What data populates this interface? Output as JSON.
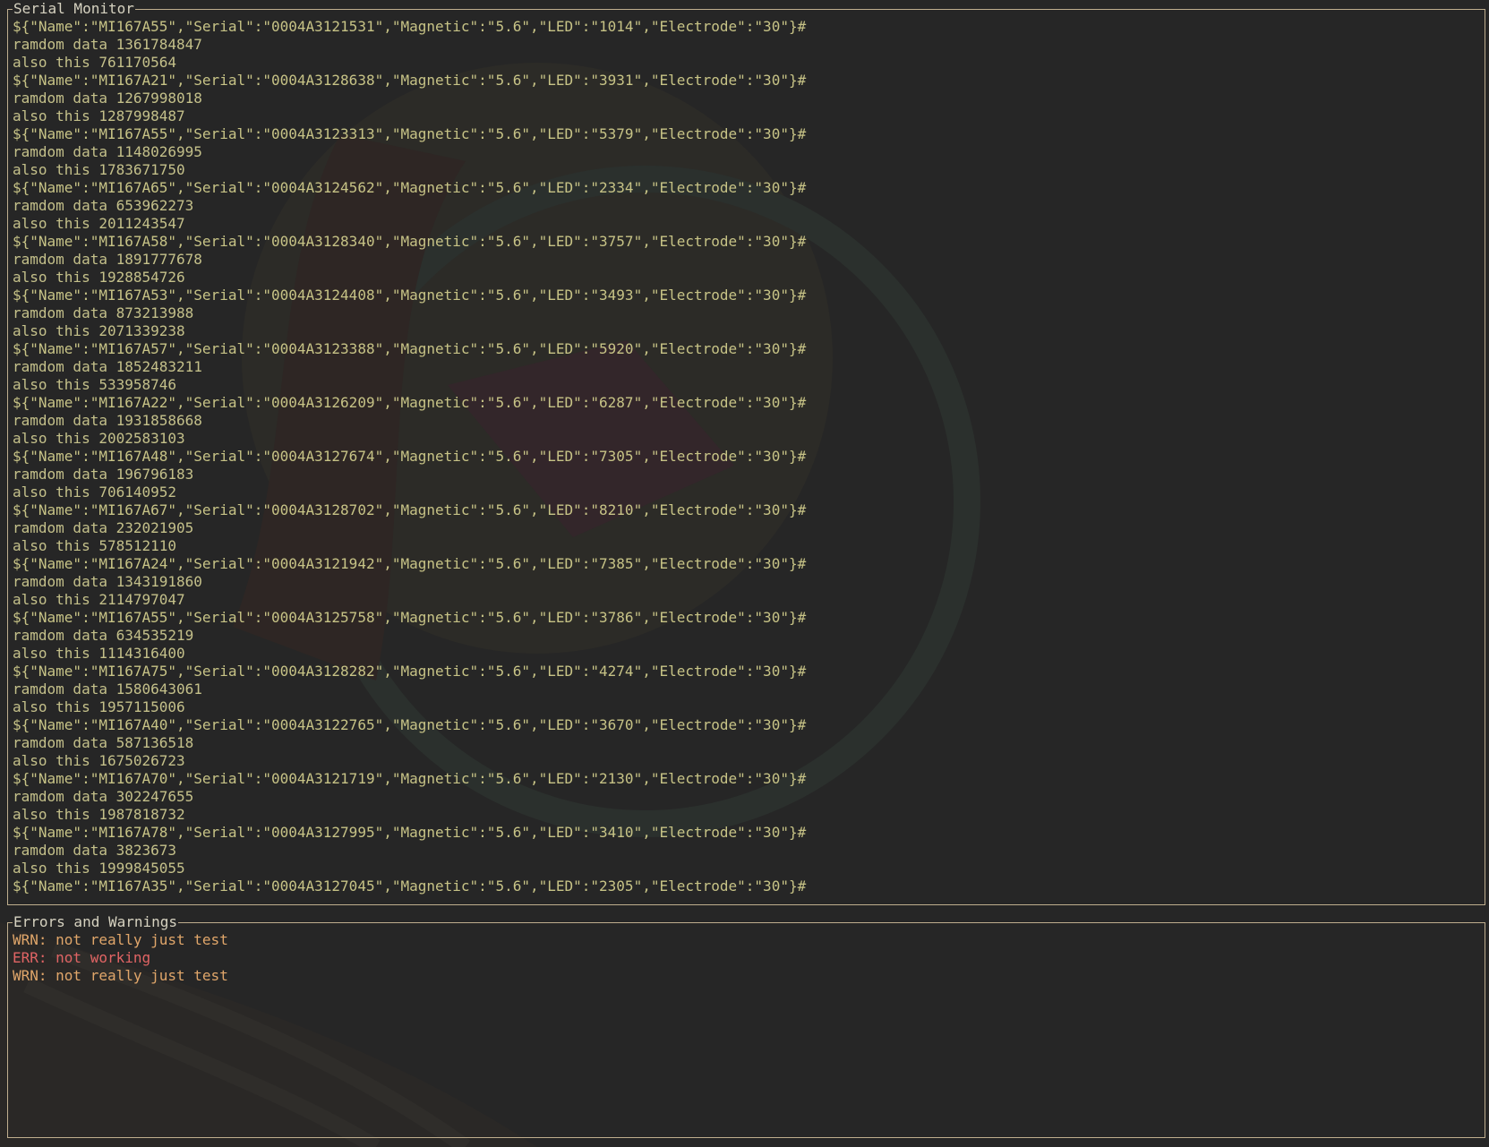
{
  "serial_monitor": {
    "title": "Serial Monitor",
    "lines": [
      "${\"Name\":\"MI167A55\",\"Serial\":\"0004A3121531\",\"Magnetic\":\"5.6\",\"LED\":\"1014\",\"Electrode\":\"30\"}#",
      "ramdom data 1361784847",
      "also this 761170564",
      "${\"Name\":\"MI167A21\",\"Serial\":\"0004A3128638\",\"Magnetic\":\"5.6\",\"LED\":\"3931\",\"Electrode\":\"30\"}#",
      "ramdom data 1267998018",
      "also this 1287998487",
      "${\"Name\":\"MI167A55\",\"Serial\":\"0004A3123313\",\"Magnetic\":\"5.6\",\"LED\":\"5379\",\"Electrode\":\"30\"}#",
      "ramdom data 1148026995",
      "also this 1783671750",
      "${\"Name\":\"MI167A65\",\"Serial\":\"0004A3124562\",\"Magnetic\":\"5.6\",\"LED\":\"2334\",\"Electrode\":\"30\"}#",
      "ramdom data 653962273",
      "also this 2011243547",
      "${\"Name\":\"MI167A58\",\"Serial\":\"0004A3128340\",\"Magnetic\":\"5.6\",\"LED\":\"3757\",\"Electrode\":\"30\"}#",
      "ramdom data 1891777678",
      "also this 1928854726",
      "${\"Name\":\"MI167A53\",\"Serial\":\"0004A3124408\",\"Magnetic\":\"5.6\",\"LED\":\"3493\",\"Electrode\":\"30\"}#",
      "ramdom data 873213988",
      "also this 2071339238",
      "${\"Name\":\"MI167A57\",\"Serial\":\"0004A3123388\",\"Magnetic\":\"5.6\",\"LED\":\"5920\",\"Electrode\":\"30\"}#",
      "ramdom data 1852483211",
      "also this 533958746",
      "${\"Name\":\"MI167A22\",\"Serial\":\"0004A3126209\",\"Magnetic\":\"5.6\",\"LED\":\"6287\",\"Electrode\":\"30\"}#",
      "ramdom data 1931858668",
      "also this 2002583103",
      "${\"Name\":\"MI167A48\",\"Serial\":\"0004A3127674\",\"Magnetic\":\"5.6\",\"LED\":\"7305\",\"Electrode\":\"30\"}#",
      "ramdom data 196796183",
      "also this 706140952",
      "${\"Name\":\"MI167A67\",\"Serial\":\"0004A3128702\",\"Magnetic\":\"5.6\",\"LED\":\"8210\",\"Electrode\":\"30\"}#",
      "ramdom data 232021905",
      "also this 578512110",
      "${\"Name\":\"MI167A24\",\"Serial\":\"0004A3121942\",\"Magnetic\":\"5.6\",\"LED\":\"7385\",\"Electrode\":\"30\"}#",
      "ramdom data 1343191860",
      "also this 2114797047",
      "${\"Name\":\"MI167A55\",\"Serial\":\"0004A3125758\",\"Magnetic\":\"5.6\",\"LED\":\"3786\",\"Electrode\":\"30\"}#",
      "ramdom data 634535219",
      "also this 1114316400",
      "${\"Name\":\"MI167A75\",\"Serial\":\"0004A3128282\",\"Magnetic\":\"5.6\",\"LED\":\"4274\",\"Electrode\":\"30\"}#",
      "ramdom data 1580643061",
      "also this 1957115006",
      "${\"Name\":\"MI167A40\",\"Serial\":\"0004A3122765\",\"Magnetic\":\"5.6\",\"LED\":\"3670\",\"Electrode\":\"30\"}#",
      "ramdom data 587136518",
      "also this 1675026723",
      "${\"Name\":\"MI167A70\",\"Serial\":\"0004A3121719\",\"Magnetic\":\"5.6\",\"LED\":\"2130\",\"Electrode\":\"30\"}#",
      "ramdom data 302247655",
      "also this 1987818732",
      "${\"Name\":\"MI167A78\",\"Serial\":\"0004A3127995\",\"Magnetic\":\"5.6\",\"LED\":\"3410\",\"Electrode\":\"30\"}#",
      "ramdom data 3823673",
      "also this 1999845055",
      "${\"Name\":\"MI167A35\",\"Serial\":\"0004A3127045\",\"Magnetic\":\"5.6\",\"LED\":\"2305\",\"Electrode\":\"30\"}#"
    ]
  },
  "errors_panel": {
    "title": "Errors and Warnings",
    "lines": [
      {
        "level": "warning",
        "text": "WRN: not really just test"
      },
      {
        "level": "error",
        "text": "ERR: not working"
      },
      {
        "level": "warning",
        "text": "WRN: not really just test"
      }
    ]
  },
  "colors": {
    "background": "#262626",
    "border": "#bfae8e",
    "json_text": "#c7c386",
    "data_text": "#c4c08a",
    "warning": "#e0a66a",
    "error": "#e06464"
  }
}
